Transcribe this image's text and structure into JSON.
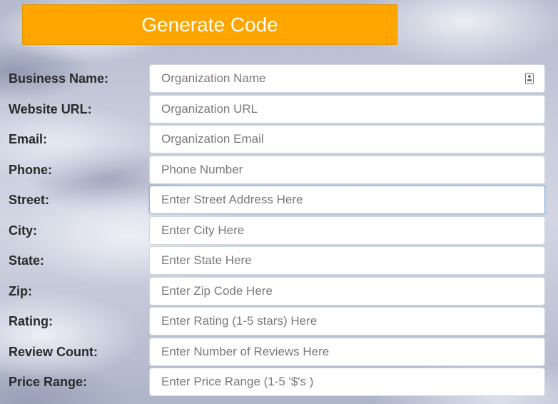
{
  "generate_button": {
    "label": "Generate Code"
  },
  "form": {
    "fields": [
      {
        "label": "Business Name:",
        "placeholder": "Organization Name",
        "value": ""
      },
      {
        "label": "Website URL:",
        "placeholder": "Organization URL",
        "value": ""
      },
      {
        "label": "Email:",
        "placeholder": "Organization Email",
        "value": ""
      },
      {
        "label": "Phone:",
        "placeholder": "Phone Number",
        "value": ""
      },
      {
        "label": "Street:",
        "placeholder": "Enter Street Address Here",
        "value": ""
      },
      {
        "label": "City:",
        "placeholder": "Enter City Here",
        "value": ""
      },
      {
        "label": "State:",
        "placeholder": "Enter State Here",
        "value": ""
      },
      {
        "label": "Zip:",
        "placeholder": "Enter Zip Code Here",
        "value": ""
      },
      {
        "label": "Rating:",
        "placeholder": "Enter Rating (1-5 stars) Here",
        "value": ""
      },
      {
        "label": "Review Count:",
        "placeholder": "Enter Number of Reviews Here",
        "value": ""
      },
      {
        "label": "Price Range:",
        "placeholder": "Enter Price Range (1-5 '$'s )",
        "value": ""
      }
    ]
  },
  "icons": {
    "business_name_field": "contact-card-icon"
  },
  "colors": {
    "button_bg": "#ffa500",
    "button_text": "#ffffff",
    "label_text": "#2a2a2a",
    "focus_border": "#8ab4e0"
  }
}
